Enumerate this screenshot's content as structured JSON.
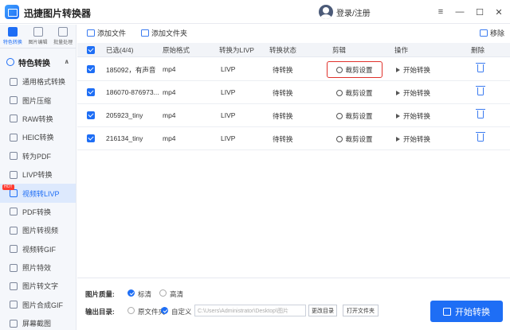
{
  "app": {
    "title": "迅捷图片转换器",
    "login": "登录/注册"
  },
  "window": {
    "menu": "≡",
    "minimize": "—",
    "maximize": "☐",
    "close": "✕"
  },
  "rail": {
    "tabs": [
      {
        "label": "特色转换",
        "active": true
      },
      {
        "label": "图片编辑",
        "active": false
      },
      {
        "label": "批量处理",
        "active": false
      }
    ],
    "section": "特色转换",
    "items": [
      {
        "label": "通用格式转换"
      },
      {
        "label": "图片压缩"
      },
      {
        "label": "RAW转换"
      },
      {
        "label": "HEIC转换"
      },
      {
        "label": "转为PDF"
      },
      {
        "label": "LIVP转换"
      },
      {
        "label": "视频转LIVP",
        "active": true,
        "badge": "HOT"
      },
      {
        "label": "PDF转换"
      },
      {
        "label": "图片转视频"
      },
      {
        "label": "视频转GIF"
      },
      {
        "label": "照片特效"
      },
      {
        "label": "图片转文字"
      },
      {
        "label": "图片合成GIF"
      },
      {
        "label": "屏幕截图"
      }
    ]
  },
  "toolbar": {
    "add_file": "添加文件",
    "add_folder": "添加文件夹",
    "remove": "移除"
  },
  "table": {
    "headers": {
      "selected": "已选(4/4)",
      "format": "原始格式",
      "target": "转换为LIVP",
      "status": "转换状态",
      "edit": "剪辑",
      "action": "操作",
      "delete": "删除"
    },
    "rows": [
      {
        "name": "185092，有声音",
        "format": "mp4",
        "target": "LIVP",
        "status": "待转换",
        "crop": "裁剪设置",
        "start": "开始转换",
        "highlighted": true
      },
      {
        "name": "186070-876973...",
        "format": "mp4",
        "target": "LIVP",
        "status": "待转换",
        "crop": "裁剪设置",
        "start": "开始转换",
        "highlighted": false
      },
      {
        "name": "205923_tiny",
        "format": "mp4",
        "target": "LIVP",
        "status": "待转换",
        "crop": "裁剪设置",
        "start": "开始转换",
        "highlighted": false
      },
      {
        "name": "216134_tiny",
        "format": "mp4",
        "target": "LIVP",
        "status": "待转换",
        "crop": "裁剪设置",
        "start": "开始转换",
        "highlighted": false
      }
    ]
  },
  "bottom": {
    "quality_label": "图片质量:",
    "quality_std": "标清",
    "quality_hd": "高清",
    "output_label": "输出目录:",
    "out_src": "原文件夹",
    "out_custom": "自定义",
    "path": "C:\\Users\\Administrator\\Desktop\\图片",
    "change_dir": "更改目录",
    "open_folder": "打开文件夹",
    "start_all": "开始转换"
  },
  "colors": {
    "accent": "#1e6ef5",
    "highlight": "#e0312b",
    "hot": "#ff3b30"
  }
}
